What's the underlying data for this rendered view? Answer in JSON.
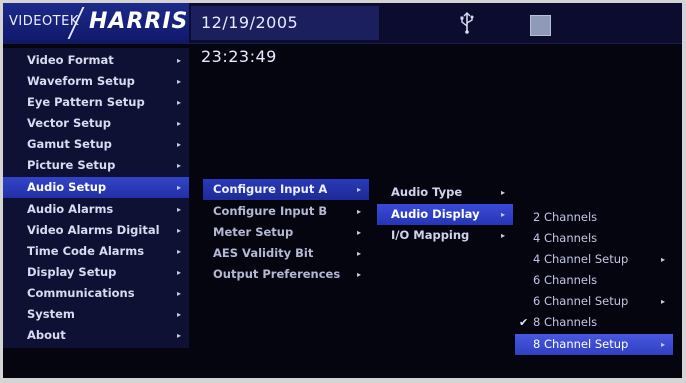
{
  "header": {
    "brand_videotek": "VIDEOTEK",
    "brand_harris": "HARRIS",
    "datetime": "12/19/2005 23:23:49"
  },
  "main_menu": [
    {
      "label": "Video Format",
      "selected": false
    },
    {
      "label": "Waveform Setup",
      "selected": false
    },
    {
      "label": "Eye Pattern Setup",
      "selected": false
    },
    {
      "label": "Vector Setup",
      "selected": false
    },
    {
      "label": "Gamut Setup",
      "selected": false
    },
    {
      "label": "Picture Setup",
      "selected": false
    },
    {
      "label": "Audio Setup",
      "selected": true
    },
    {
      "label": "Audio Alarms",
      "selected": false
    },
    {
      "label": "Video Alarms Digital",
      "selected": false
    },
    {
      "label": "Time Code Alarms",
      "selected": false
    },
    {
      "label": "Display Setup",
      "selected": false
    },
    {
      "label": "Communications",
      "selected": false
    },
    {
      "label": "System",
      "selected": false
    },
    {
      "label": "About",
      "selected": false
    }
  ],
  "audio_setup_menu": [
    {
      "label": "Configure Input A",
      "selected": true
    },
    {
      "label": "Configure Input B",
      "selected": false
    },
    {
      "label": "Meter Setup",
      "selected": false
    },
    {
      "label": "AES Validity Bit",
      "selected": false
    },
    {
      "label": "Output Preferences",
      "selected": false
    }
  ],
  "configure_input_menu": [
    {
      "label": "Audio Type",
      "selected": false
    },
    {
      "label": "Audio Display",
      "selected": true
    },
    {
      "label": "I/O Mapping",
      "selected": false
    }
  ],
  "audio_display_menu": [
    {
      "label": "2 Channels",
      "submenu": false,
      "checked": false,
      "selected": false
    },
    {
      "label": "4 Channels",
      "submenu": false,
      "checked": false,
      "selected": false
    },
    {
      "label": "4 Channel Setup",
      "submenu": true,
      "checked": false,
      "selected": false
    },
    {
      "label": "6 Channels",
      "submenu": false,
      "checked": false,
      "selected": false
    },
    {
      "label": "6 Channel Setup",
      "submenu": true,
      "checked": false,
      "selected": false
    },
    {
      "label": "8 Channels",
      "submenu": false,
      "checked": true,
      "selected": false
    },
    {
      "label": "8 Channel Setup",
      "submenu": true,
      "checked": false,
      "selected": true
    }
  ],
  "glyphs": {
    "arrow": "▸",
    "check": "✔"
  }
}
